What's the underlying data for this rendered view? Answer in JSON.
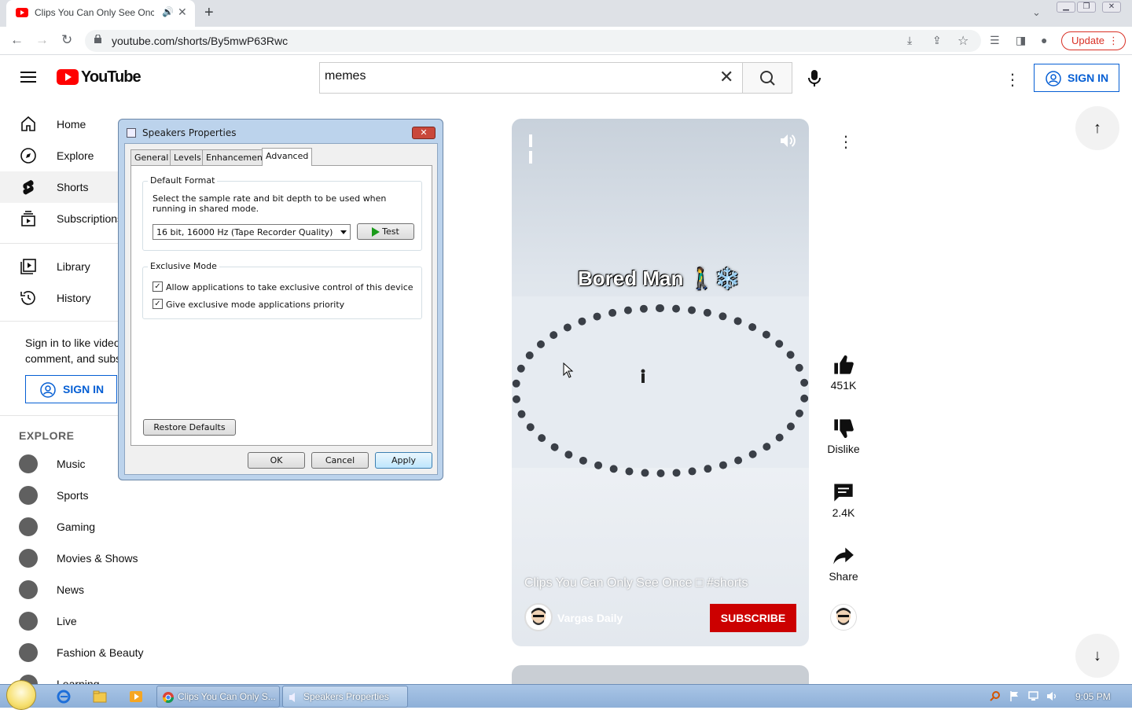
{
  "browser": {
    "tab_title": "Clips You Can Only See Once",
    "url": "youtube.com/shorts/By5mwP63Rwc",
    "update_label": "Update",
    "accent": "#d93025"
  },
  "youtube": {
    "logo_text": "YouTube",
    "search_value": "memes",
    "sign_in_label": "SIGN IN",
    "brand_red": "#ff0000",
    "link_blue": "#065fd4"
  },
  "sidebar": {
    "items": [
      {
        "label": "Home",
        "icon": "home-icon"
      },
      {
        "label": "Explore",
        "icon": "compass-icon"
      },
      {
        "label": "Shorts",
        "icon": "shorts-icon"
      },
      {
        "label": "Subscriptions",
        "icon": "subscriptions-icon"
      },
      {
        "label": "Library",
        "icon": "library-icon"
      },
      {
        "label": "History",
        "icon": "history-icon"
      }
    ],
    "signin_text": "Sign in to like videos, comment, and subscribe.",
    "signin_label": "SIGN IN",
    "explore_heading": "EXPLORE",
    "explore_items": [
      {
        "label": "Music",
        "icon": "music-icon"
      },
      {
        "label": "Sports",
        "icon": "trophy-icon"
      },
      {
        "label": "Gaming",
        "icon": "gamepad-icon"
      },
      {
        "label": "Movies & Shows",
        "icon": "film-icon"
      },
      {
        "label": "News",
        "icon": "news-icon"
      },
      {
        "label": "Live",
        "icon": "live-icon"
      },
      {
        "label": "Fashion & Beauty",
        "icon": "hanger-icon"
      },
      {
        "label": "Learning",
        "icon": "bulb-icon"
      }
    ]
  },
  "short": {
    "overlay_title": "Bored Man 🚶‍♂️❄️",
    "caption": "Clips You Can Only See Once □ #shorts",
    "channel": "Vargas Daily",
    "subscribe_label": "SUBSCRIBE",
    "likes": "451K",
    "dislike_label": "Dislike",
    "comments": "2.4K",
    "share_label": "Share"
  },
  "dialog": {
    "title": "Speakers Properties",
    "tabs": [
      "General",
      "Levels",
      "Enhancements",
      "Advanced"
    ],
    "active_tab": "Advanced",
    "default_format_title": "Default Format",
    "default_format_desc": "Select the sample rate and bit depth to be used when running in shared mode.",
    "format_value": "16 bit, 16000 Hz (Tape Recorder Quality)",
    "test_label": "Test",
    "exclusive_title": "Exclusive Mode",
    "exclusive_opt1": "Allow applications to take exclusive control of this device",
    "exclusive_opt2": "Give exclusive mode applications priority",
    "opt1_checked": true,
    "opt2_checked": true,
    "restore_label": "Restore Defaults",
    "ok_label": "OK",
    "cancel_label": "Cancel",
    "apply_label": "Apply"
  },
  "taskbar": {
    "tasks": [
      "Clips You Can Only S...",
      "Speakers Properties"
    ],
    "clock": "9:05 PM"
  }
}
